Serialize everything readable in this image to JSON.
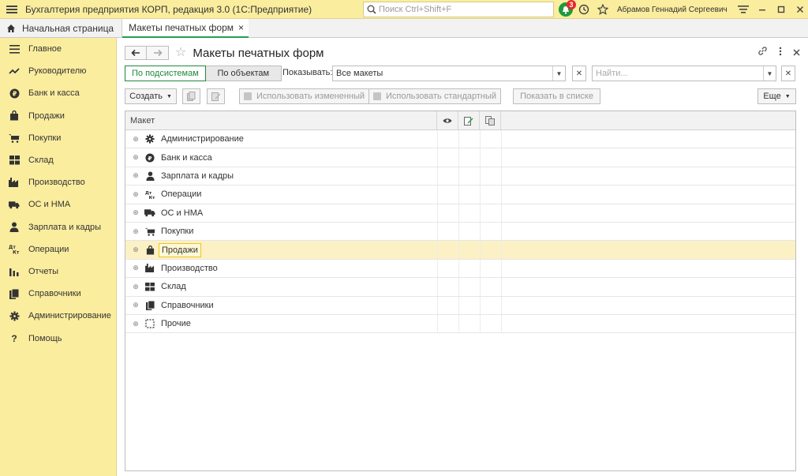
{
  "app": {
    "title": "Бухгалтерия предприятия КОРП, редакция 3.0  (1С:Предприятие)",
    "search_placeholder": "Поиск Ctrl+Shift+F",
    "notifications_count": "3",
    "user": "Абрамов Геннадий Сергеевич",
    "accent_color": "#1e8a3c",
    "sidebar_color": "#fbed9e"
  },
  "tabs": {
    "home": "Начальная страница",
    "active": "Макеты печатных форм",
    "close_glyph": "×"
  },
  "sidebar": {
    "items": [
      {
        "label": "Главное",
        "icon": "menu-icon"
      },
      {
        "label": "Руководителю",
        "icon": "trend-icon"
      },
      {
        "label": "Банк и касса",
        "icon": "ruble-icon"
      },
      {
        "label": "Продажи",
        "icon": "bag-icon"
      },
      {
        "label": "Покупки",
        "icon": "cart-icon"
      },
      {
        "label": "Склад",
        "icon": "warehouse-icon"
      },
      {
        "label": "Производство",
        "icon": "factory-icon"
      },
      {
        "label": "ОС и НМА",
        "icon": "truck-icon"
      },
      {
        "label": "Зарплата и кадры",
        "icon": "person-icon"
      },
      {
        "label": "Операции",
        "icon": "dt-kt-icon"
      },
      {
        "label": "Отчеты",
        "icon": "bar-chart-icon"
      },
      {
        "label": "Справочники",
        "icon": "books-icon"
      },
      {
        "label": "Администрирование",
        "icon": "gear-icon"
      },
      {
        "label": "Помощь",
        "icon": "question-icon"
      }
    ]
  },
  "page": {
    "title": "Макеты печатных форм",
    "by_subsystems": "По подсистемам",
    "by_objects": "По объектам",
    "show_label": "Показывать:",
    "show_value": "Все макеты",
    "find_placeholder": "Найти...",
    "create": "Создать",
    "use_modified": "Использовать измененный",
    "use_standard": "Использовать стандартный",
    "show_in_list": "Показать в списке",
    "more": "Еще"
  },
  "table": {
    "column_name": "Макет",
    "rows": [
      {
        "label": "Администрирование",
        "icon": "gear-icon"
      },
      {
        "label": "Банк и касса",
        "icon": "ruble-icon"
      },
      {
        "label": "Зарплата и кадры",
        "icon": "person-icon"
      },
      {
        "label": "Операции",
        "icon": "dt-kt-icon"
      },
      {
        "label": "ОС и НМА",
        "icon": "truck-icon"
      },
      {
        "label": "Покупки",
        "icon": "cart-icon"
      },
      {
        "label": "Продажи",
        "icon": "bag-icon",
        "selected": true
      },
      {
        "label": "Производство",
        "icon": "factory-icon"
      },
      {
        "label": "Склад",
        "icon": "warehouse-icon"
      },
      {
        "label": "Справочники",
        "icon": "books-icon"
      },
      {
        "label": "Прочие",
        "icon": "folder-dashed-icon"
      }
    ]
  }
}
